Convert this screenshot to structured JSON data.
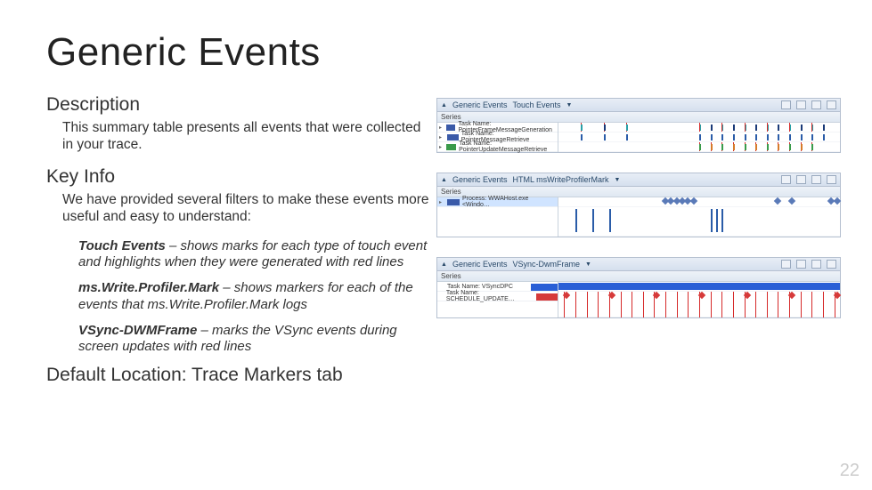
{
  "title": "Generic Events",
  "sections": {
    "description": {
      "heading": "Description",
      "body": "This summary table presents all events that were collected in your trace."
    },
    "keyinfo": {
      "heading": "Key Info",
      "intro": "We have provided several filters to make these events more useful and easy to understand:",
      "filters": [
        {
          "name": "Touch Events",
          "desc": " – shows marks for each type of touch event and highlights when they were generated with red lines"
        },
        {
          "name": "ms.Write.Profiler.Mark",
          "desc": " – shows markers for each of the events that ms.Write.Profiler.Mark logs"
        },
        {
          "name": "VSync-DWMFrame",
          "desc": " – marks the VSync events during screen updates with red lines"
        }
      ]
    },
    "default_location": "Default Location: Trace Markers tab"
  },
  "panels": [
    {
      "title_icon": "▲",
      "title_prefix": "Generic Events",
      "title_name": "Touch Events",
      "series_label": "Series",
      "legend": [
        {
          "label": "Task Name: PointerFrameMessageGeneration",
          "color": "#3a5aa8"
        },
        {
          "label": "Task Name: PointerMessageRetrieve",
          "color": "#3a5aa8"
        },
        {
          "label": "Task Name: PointerUpdateMessageRetrieve",
          "color": "#3a9a4a"
        }
      ]
    },
    {
      "title_icon": "▲",
      "title_prefix": "Generic Events",
      "title_name": "HTML msWriteProfilerMark",
      "series_label": "Series",
      "legend": [
        {
          "label": "Process: WWAHost.exe <Windo…",
          "color": "#3a5aa8"
        }
      ]
    },
    {
      "title_icon": "▲",
      "title_prefix": "Generic Events",
      "title_name": "VSync-DwmFrame",
      "series_label": "Series",
      "legend": [
        {
          "label": "Task Name: VSyncDPC",
          "color": "#3a5aa8"
        },
        {
          "label": "Task Name: SCHEDULE_UPDATE…",
          "color": "#d63a3a"
        }
      ]
    }
  ],
  "page_number": "22"
}
